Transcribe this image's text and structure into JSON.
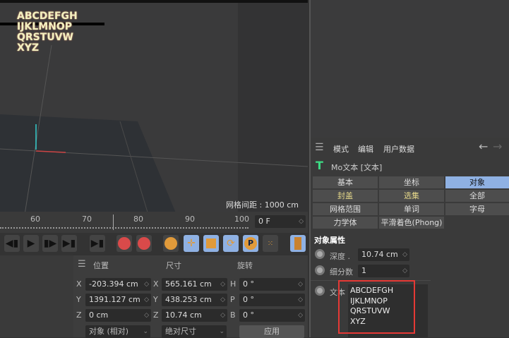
{
  "viewport": {
    "text_lines": [
      "ABCDEFGH",
      "IJKLMNOP",
      "QRSTUVW",
      "XYZ"
    ],
    "grid_spacing": "网格间距 : 1000 cm"
  },
  "timeline": {
    "ticks": [
      "60",
      "70",
      "80",
      "90",
      "100"
    ],
    "frame": "0 F"
  },
  "coords": {
    "header": {
      "position": "位置",
      "size": "尺寸",
      "rotation": "旋转"
    },
    "rows": [
      {
        "pl": "X",
        "pv": "-203.394 cm",
        "sl": "X",
        "sv": "565.161 cm",
        "rl": "H",
        "rv": "0 °"
      },
      {
        "pl": "Y",
        "pv": "1391.127 cm",
        "sl": "Y",
        "sv": "438.253 cm",
        "rl": "P",
        "rv": "0 °"
      },
      {
        "pl": "Z",
        "pv": "0 cm",
        "sl": "Z",
        "sv": "10.74 cm",
        "rl": "B",
        "rv": "0 °"
      }
    ],
    "mode_select": "对象 (相对)",
    "size_select": "绝对尺寸",
    "apply": "应用"
  },
  "attributes": {
    "menu": [
      "模式",
      "编辑",
      "用户数据"
    ],
    "object_title": "Mo文本 [文本]",
    "tabs": [
      "基本",
      "坐标",
      "对象",
      "封盖",
      "选集",
      "全部",
      "网格范围",
      "单词",
      "字母",
      "力学体",
      "平滑着色(Phong)"
    ],
    "section": "对象属性",
    "depth_label": "深度 .",
    "depth_value": "10.74 cm",
    "subdiv_label": "细分数",
    "subdiv_value": "1",
    "text_label": "文本",
    "text_value": [
      "ABCDEFGH",
      "IJKLMNOP",
      "QRSTUVW",
      "XYZ"
    ]
  },
  "colors": {
    "accent": "#8fb1e3",
    "highlight": "#e53935",
    "motext_icon": "#3ddc84"
  }
}
